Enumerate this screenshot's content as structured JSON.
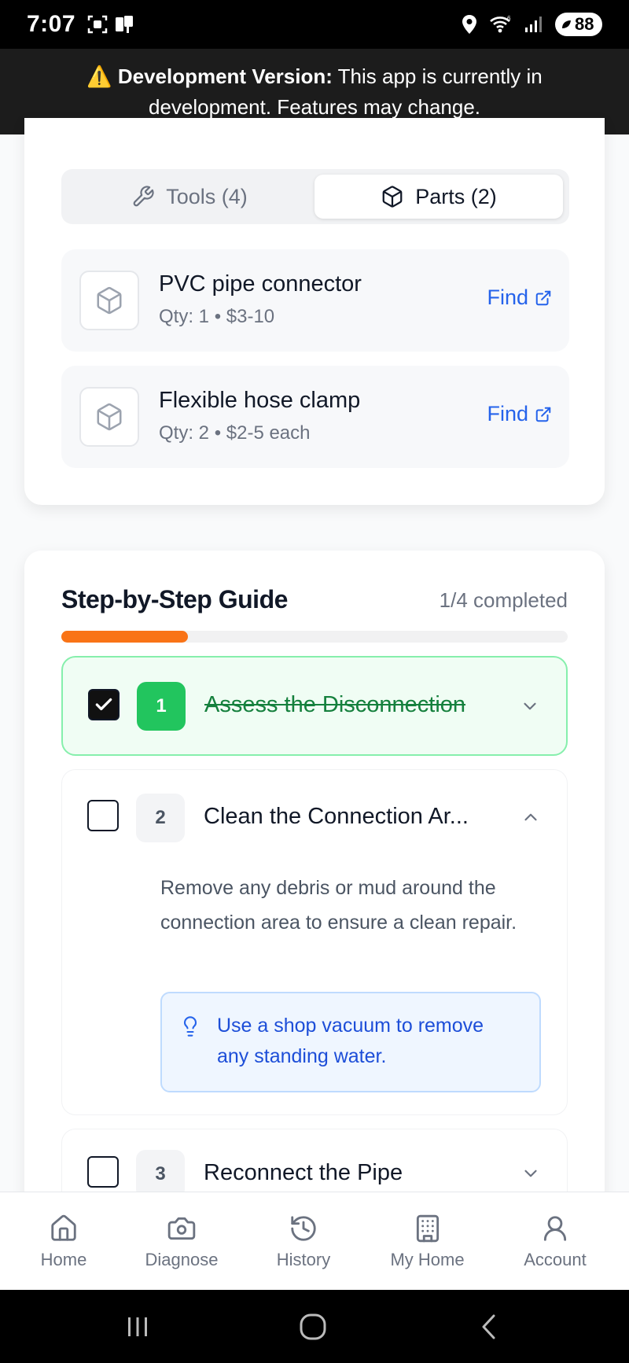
{
  "status_bar": {
    "time": "7:07",
    "battery": "88"
  },
  "dev_banner": {
    "emoji": "⚠️",
    "bold_label": "Development Version:",
    "line1_rest": " This app is currently in",
    "line2": "development. Features may change."
  },
  "tabs": [
    {
      "label": "Tools (4)",
      "icon": "wrench-icon",
      "active": false
    },
    {
      "label": "Parts (2)",
      "icon": "box-icon",
      "active": true
    }
  ],
  "parts": [
    {
      "name": "PVC pipe connector",
      "meta": "Qty: 1 • $3-10",
      "action": "Find"
    },
    {
      "name": "Flexible hose clamp",
      "meta": "Qty: 2 • $2-5 each",
      "action": "Find"
    }
  ],
  "guide": {
    "title": "Step-by-Step Guide",
    "progress_text": "1/4 completed",
    "progress_fraction": 0.25,
    "accent_color": "#f97316",
    "steps": [
      {
        "number": "1",
        "title": "Assess the Disconnection",
        "completed": true,
        "expanded": false
      },
      {
        "number": "2",
        "title": "Clean the Connection Ar...",
        "completed": false,
        "expanded": true,
        "description": "Remove any debris or mud around the connection area to ensure a clean repair.",
        "tip": "Use a shop vacuum to remove any standing water."
      },
      {
        "number": "3",
        "title": "Reconnect the Pipe",
        "completed": false,
        "expanded": false
      }
    ]
  },
  "bottom_nav": [
    {
      "label": "Home",
      "icon": "home-icon"
    },
    {
      "label": "Diagnose",
      "icon": "camera-icon"
    },
    {
      "label": "History",
      "icon": "history-icon"
    },
    {
      "label": "My Home",
      "icon": "building-icon"
    },
    {
      "label": "Account",
      "icon": "user-icon"
    }
  ],
  "colors": {
    "done_green": "#22c55e",
    "link_blue": "#2563eb",
    "tip_blue": "#1d4ed8"
  }
}
